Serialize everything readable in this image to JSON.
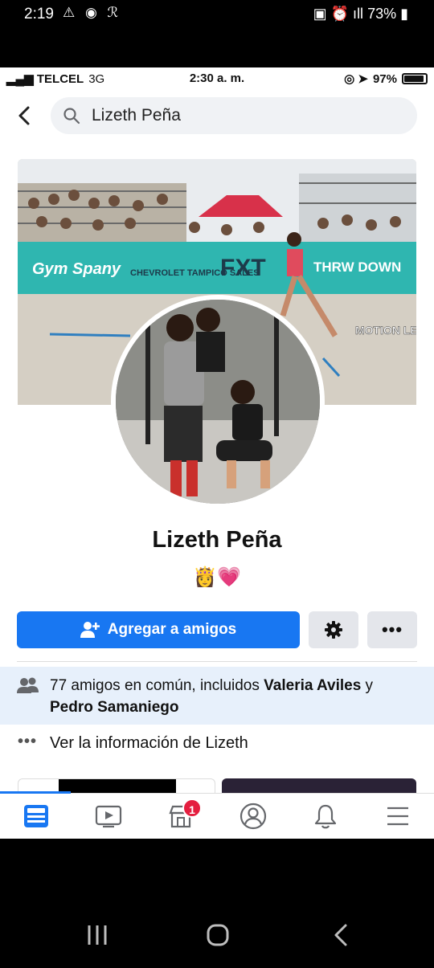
{
  "outer_status": {
    "time": "2:19",
    "right_text": "73%"
  },
  "inner_status": {
    "carrier": "TELCEL",
    "network": "3G",
    "time": "2:30 a. m.",
    "battery": "97%"
  },
  "search": {
    "query": "Lizeth Peña"
  },
  "cover": {
    "banner_texts": [
      "Gym Spany",
      "CHEVROLET TAMPICO SALES",
      "FXT",
      "THRW DOWN",
      "MOTION LESS"
    ]
  },
  "profile": {
    "name": "Lizeth Peña",
    "emojis": "👸💗"
  },
  "actions": {
    "add_friend_label": "Agregar a amigos"
  },
  "mutual": {
    "prefix": "77 amigos en común, incluidos ",
    "friend1": "Valeria Aviles",
    "joiner": " y ",
    "friend2": "Pedro Samaniego"
  },
  "info": {
    "label": "Ver la información de Lizeth"
  },
  "tabbar": {
    "tabs": [
      "home-feed",
      "watch",
      "marketplace",
      "profile",
      "notifications",
      "menu"
    ],
    "marketplace_badge": "1",
    "accent": "#1877f2"
  },
  "colors": {
    "primary": "#1877f2",
    "badge": "#e41e3f",
    "mutual_bg": "#e7f0fb"
  }
}
